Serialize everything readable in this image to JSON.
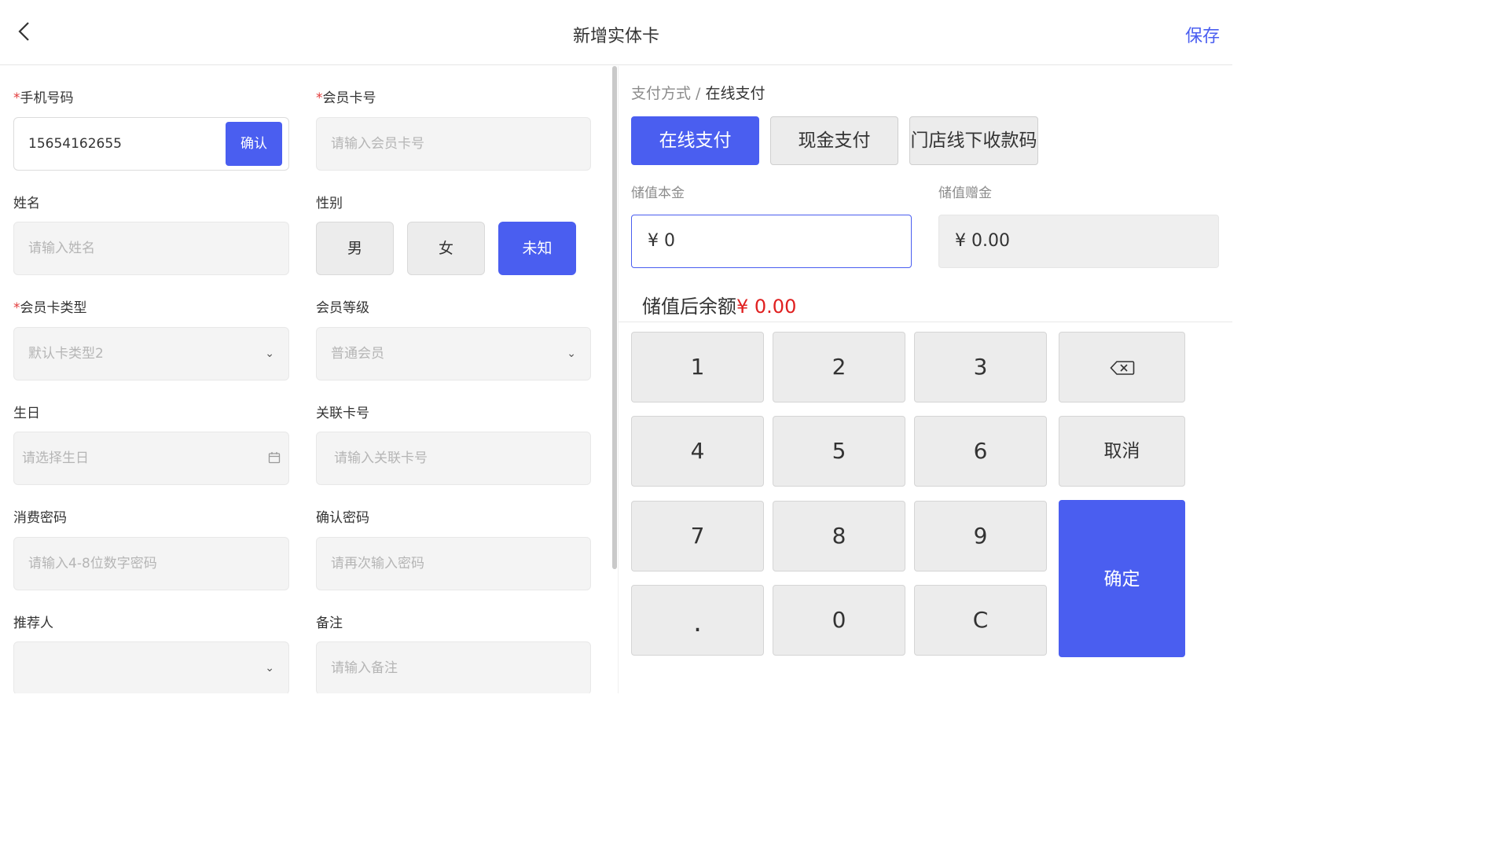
{
  "header": {
    "title": "新增实体卡",
    "save_label": "保存"
  },
  "form": {
    "phone": {
      "label": "手机号码",
      "value": "15654162655",
      "confirm_label": "确认"
    },
    "card_no": {
      "label": "会员卡号",
      "placeholder": "请输入会员卡号"
    },
    "name": {
      "label": "姓名",
      "placeholder": "请输入姓名"
    },
    "gender": {
      "label": "性别",
      "options": [
        "男",
        "女",
        "未知"
      ],
      "selected": "未知"
    },
    "card_type": {
      "label": "会员卡类型",
      "value": "默认卡类型2"
    },
    "level": {
      "label": "会员等级",
      "value": "普通会员"
    },
    "birthday": {
      "label": "生日",
      "placeholder": "请选择生日"
    },
    "linked_card": {
      "label": "关联卡号",
      "placeholder": "请输入关联卡号"
    },
    "pay_password": {
      "label": "消费密码",
      "placeholder": "请输入4-8位数字密码"
    },
    "confirm_password": {
      "label": "确认密码",
      "placeholder": "请再次输入密码"
    },
    "referrer": {
      "label": "推荐人",
      "value": ""
    },
    "remark": {
      "label": "备注",
      "placeholder": "请输入备注"
    },
    "required_mark": "*"
  },
  "payment": {
    "crumb_label": "支付方式 /",
    "crumb_current": "在线支付",
    "methods": [
      "在线支付",
      "现金支付",
      "门店线下收款码"
    ],
    "selected_method": "在线支付",
    "principal_label": "储值本金",
    "principal_value": "¥ 0",
    "bonus_label": "储值赠金",
    "bonus_value": "¥ 0.00",
    "balance_label": "储值后余额",
    "balance_value": "¥ 0.00"
  },
  "keypad": {
    "digits": [
      "1",
      "2",
      "3",
      "4",
      "5",
      "6",
      "7",
      "8",
      "9",
      ".",
      "0",
      "C"
    ],
    "backspace_icon": "backspace-icon",
    "cancel_label": "取消",
    "ok_label": "确定"
  },
  "colors": {
    "accent": "#4a5ef0",
    "danger": "#e02020"
  }
}
